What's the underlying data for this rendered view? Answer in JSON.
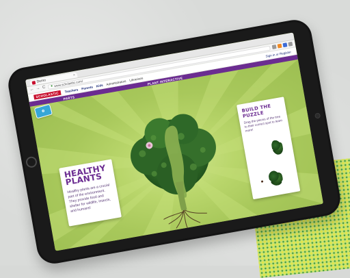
{
  "browser": {
    "tab_label": "Demo",
    "tab_close": "×",
    "url": "www.scholastic.com/",
    "back": "←",
    "forward": "→",
    "reload": "C"
  },
  "site": {
    "brand": "SCHOLASTIC",
    "nav_links": [
      "Teachers",
      "Parents",
      "Kids",
      "Administrators",
      "Librarians"
    ],
    "signin": "Sign in or Register"
  },
  "plant_bar": {
    "left": "PARTS",
    "center": "PLANT INTERACTIVE",
    "right": "",
    "far": ""
  },
  "cards": {
    "healthy": {
      "title_line1": "HEALTHY",
      "title_line2": "PLANTS",
      "body": "Healthy plants are a crucial part of the environment. They provide food and shelter for wildlife, insects, and humans!"
    },
    "puzzle": {
      "title": "BUILD THE PUZZLE",
      "body": "Drag the pieces of the tree to their correct spot to learn more!"
    }
  },
  "colors": {
    "accent_purple": "#6b2c91",
    "brand_red": "#c8102e",
    "screen_green": "#a8c85b"
  }
}
